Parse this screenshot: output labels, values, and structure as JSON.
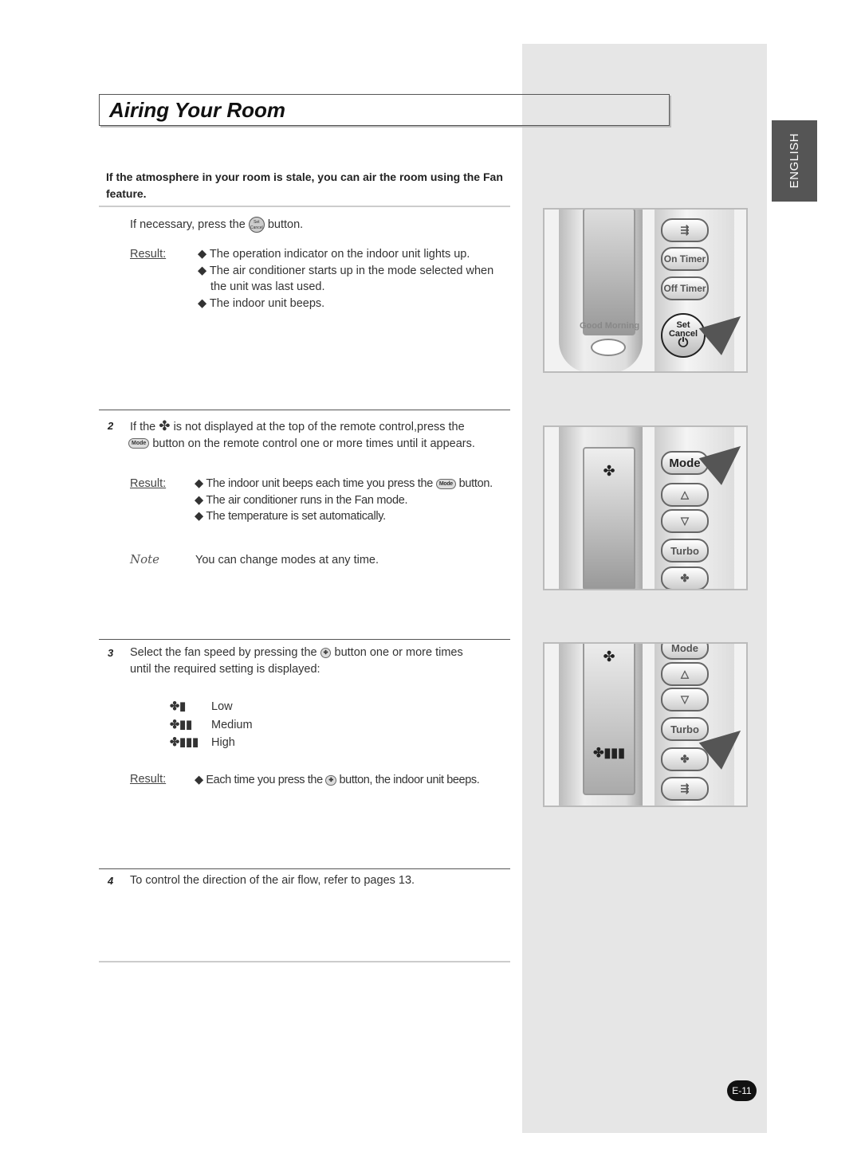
{
  "title": "Airing Your Room",
  "language_tab": "ENGLISH",
  "intro": "If the atmosphere in your room is stale, you can air the room using the Fan feature.",
  "step1": {
    "text_before": "If necessary, press the",
    "text_after": "button.",
    "button_icon": "set-cancel-button",
    "result_label": "Result:",
    "results": [
      "The operation indicator on the indoor unit lights up.",
      "The air conditioner starts up in the mode selected when the unit was last used.",
      "The indoor unit beeps."
    ]
  },
  "step2": {
    "number": "2",
    "line1_before": "If the",
    "line1_after": "is not displayed at the top of the remote control,press the",
    "line2_after": "button on the remote control one or more times until it appears.",
    "mode_pill": "Mode",
    "result_label": "Result:",
    "result1_before": "The indoor unit beeps each time you press the",
    "result1_after": "button.",
    "results": [
      "The air conditioner runs in the Fan mode.",
      "The temperature is set automatically."
    ],
    "note_label": "Note",
    "note": "You can change modes at any time."
  },
  "step3": {
    "number": "3",
    "line1_before": "Select the fan speed by pressing the",
    "line1_after": "button one or more times",
    "line2": "until the required setting is displayed:",
    "speeds": [
      "Low",
      "Medium",
      "High"
    ],
    "result_label": "Result:",
    "result_before": "Each time you press the",
    "result_after": "button, the indoor unit beeps."
  },
  "step4": {
    "number": "4",
    "text": "To control the direction of the air flow, refer to pages 13."
  },
  "remote": {
    "good_morning": "Good Morning",
    "on_timer": "On Timer",
    "off_timer": "Off Timer",
    "set": "Set",
    "cancel": "Cancel",
    "mode": "Mode",
    "turbo": "Turbo"
  },
  "page_number": "E-11"
}
